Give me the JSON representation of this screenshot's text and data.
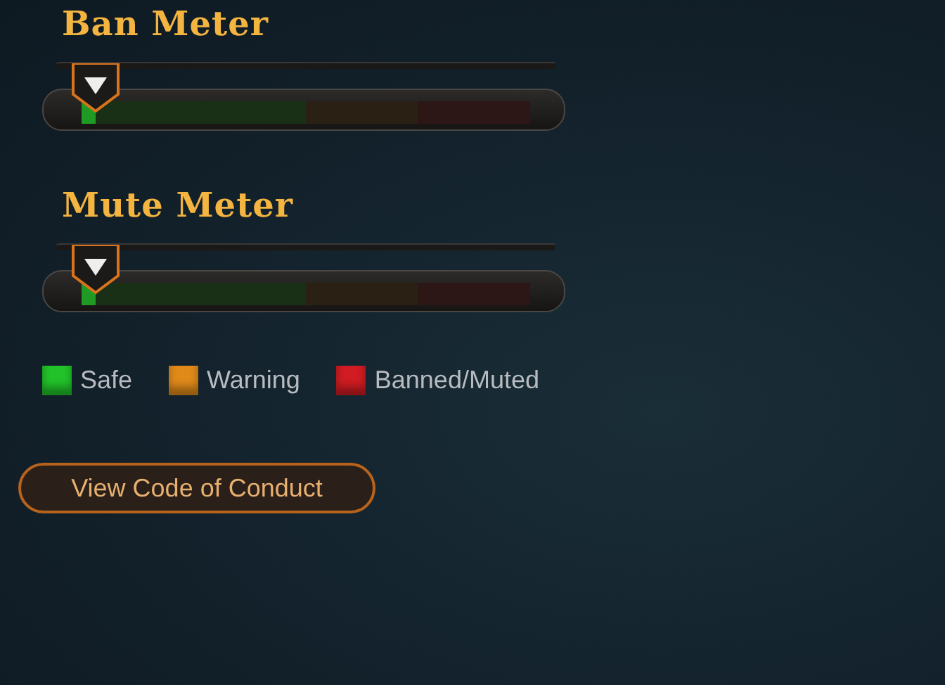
{
  "meters": [
    {
      "title": "Ban Meter",
      "level": 0.03
    },
    {
      "title": "Mute Meter",
      "level": 0.03
    }
  ],
  "legend": [
    {
      "label": "Safe",
      "color": "#22c22a"
    },
    {
      "label": "Warning",
      "color": "#e08a1a"
    },
    {
      "label": "Banned/Muted",
      "color": "#d01c22"
    }
  ],
  "button": {
    "label": "View Code of Conduct"
  }
}
